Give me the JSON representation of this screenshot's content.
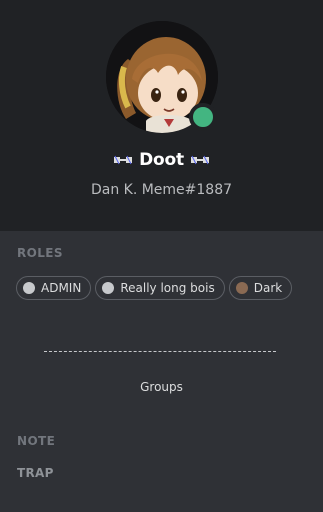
{
  "profile": {
    "username": "Doot",
    "tag": "Dan K. Meme#1887",
    "status_color": "#43b581",
    "username_icon": "space-station-icon"
  },
  "roles": {
    "title": "ROLES",
    "items": [
      {
        "label": "ADMIN",
        "color": "#c7c9cc"
      },
      {
        "label": "Really long bois",
        "color": "#c7c9cc"
      },
      {
        "label": "Dark",
        "color": "#8a6a53"
      }
    ]
  },
  "groups": {
    "label": "Groups"
  },
  "note": {
    "title": "NOTE",
    "value": "TRAP"
  },
  "colors": {
    "header_bg": "#202225",
    "body_bg": "#2f3136",
    "status_online": "#43b581"
  }
}
